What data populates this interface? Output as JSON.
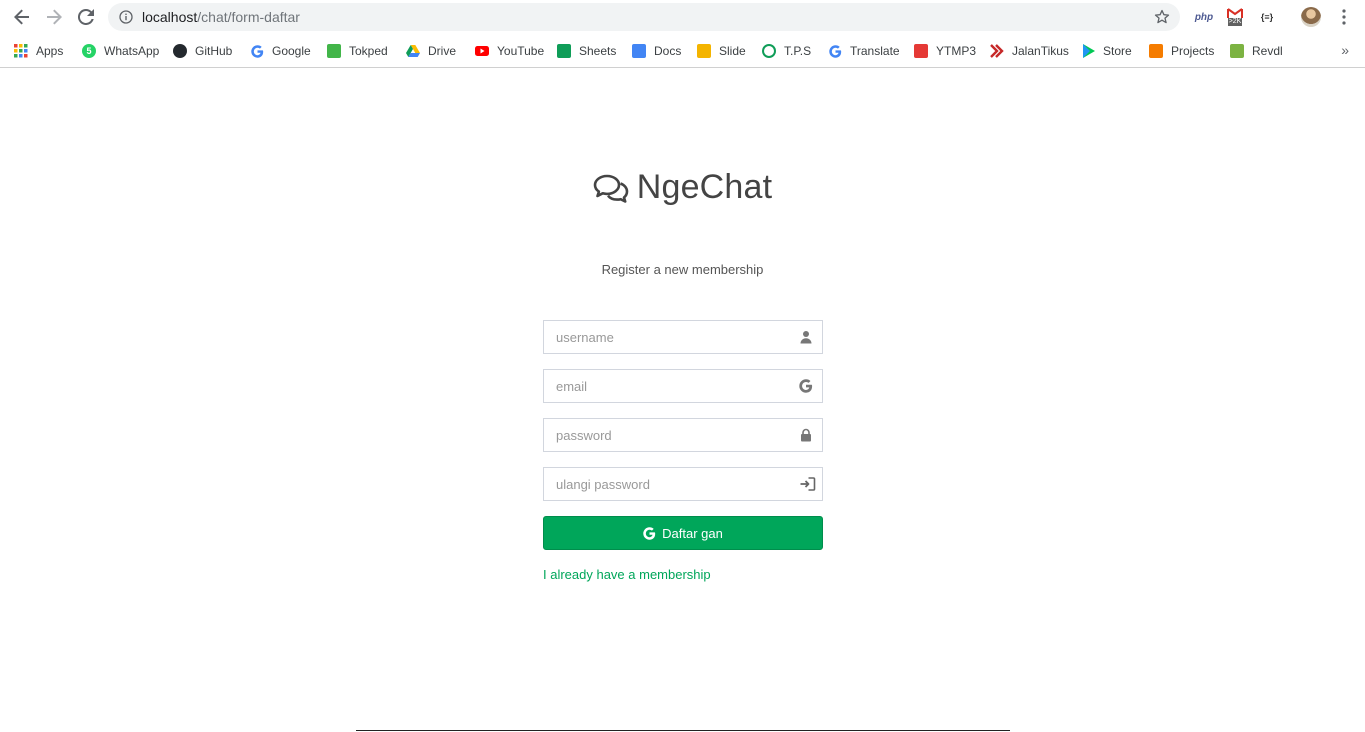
{
  "browser": {
    "url_host": "localhost",
    "url_path": "/chat/form-daftar",
    "extensions": [
      {
        "name": "php-extension",
        "label": "php"
      },
      {
        "name": "gmail-extension",
        "label": ">2K"
      },
      {
        "name": "json-extension",
        "label": "{≡}"
      }
    ]
  },
  "bookmarks": [
    {
      "label": "Apps",
      "icon": "apps-grid-icon",
      "color": "#4285f4"
    },
    {
      "label": "WhatsApp",
      "icon": "whatsapp-icon",
      "color": "#25d366"
    },
    {
      "label": "GitHub",
      "icon": "github-icon",
      "color": "#24292e"
    },
    {
      "label": "Google",
      "icon": "google-icon",
      "color": "#4285f4"
    },
    {
      "label": "Tokped",
      "icon": "tokopedia-icon",
      "color": "#42b549"
    },
    {
      "label": "Drive",
      "icon": "drive-icon",
      "color": "#fbbc04"
    },
    {
      "label": "YouTube",
      "icon": "youtube-icon",
      "color": "#ff0000"
    },
    {
      "label": "Sheets",
      "icon": "sheets-icon",
      "color": "#0f9d58"
    },
    {
      "label": "Docs",
      "icon": "docs-icon",
      "color": "#4285f4"
    },
    {
      "label": "Slide",
      "icon": "slides-icon",
      "color": "#f4b400"
    },
    {
      "label": "T.P.S",
      "icon": "tps-icon",
      "color": "#0f9d58"
    },
    {
      "label": "Translate",
      "icon": "google-icon",
      "color": "#4285f4"
    },
    {
      "label": "YTMP3",
      "icon": "download-icon",
      "color": "#e53935"
    },
    {
      "label": "JalanTikus",
      "icon": "jalantikus-icon",
      "color": "#c62828"
    },
    {
      "label": "Store",
      "icon": "play-store-icon",
      "color": "#00c853"
    },
    {
      "label": "Projects",
      "icon": "projects-icon",
      "color": "#f57c00"
    },
    {
      "label": "Revdl",
      "icon": "revdl-icon",
      "color": "#7cb342"
    }
  ],
  "page": {
    "brand": "NgeChat",
    "subtitle": "Register a new membership",
    "form": {
      "username_placeholder": "username",
      "email_placeholder": "email",
      "password_placeholder": "password",
      "repeat_password_placeholder": "ulangi password",
      "submit_label": "Daftar gan",
      "login_link": "I already have a membership"
    },
    "colors": {
      "accent": "#00a65a",
      "text": "#444444"
    }
  }
}
